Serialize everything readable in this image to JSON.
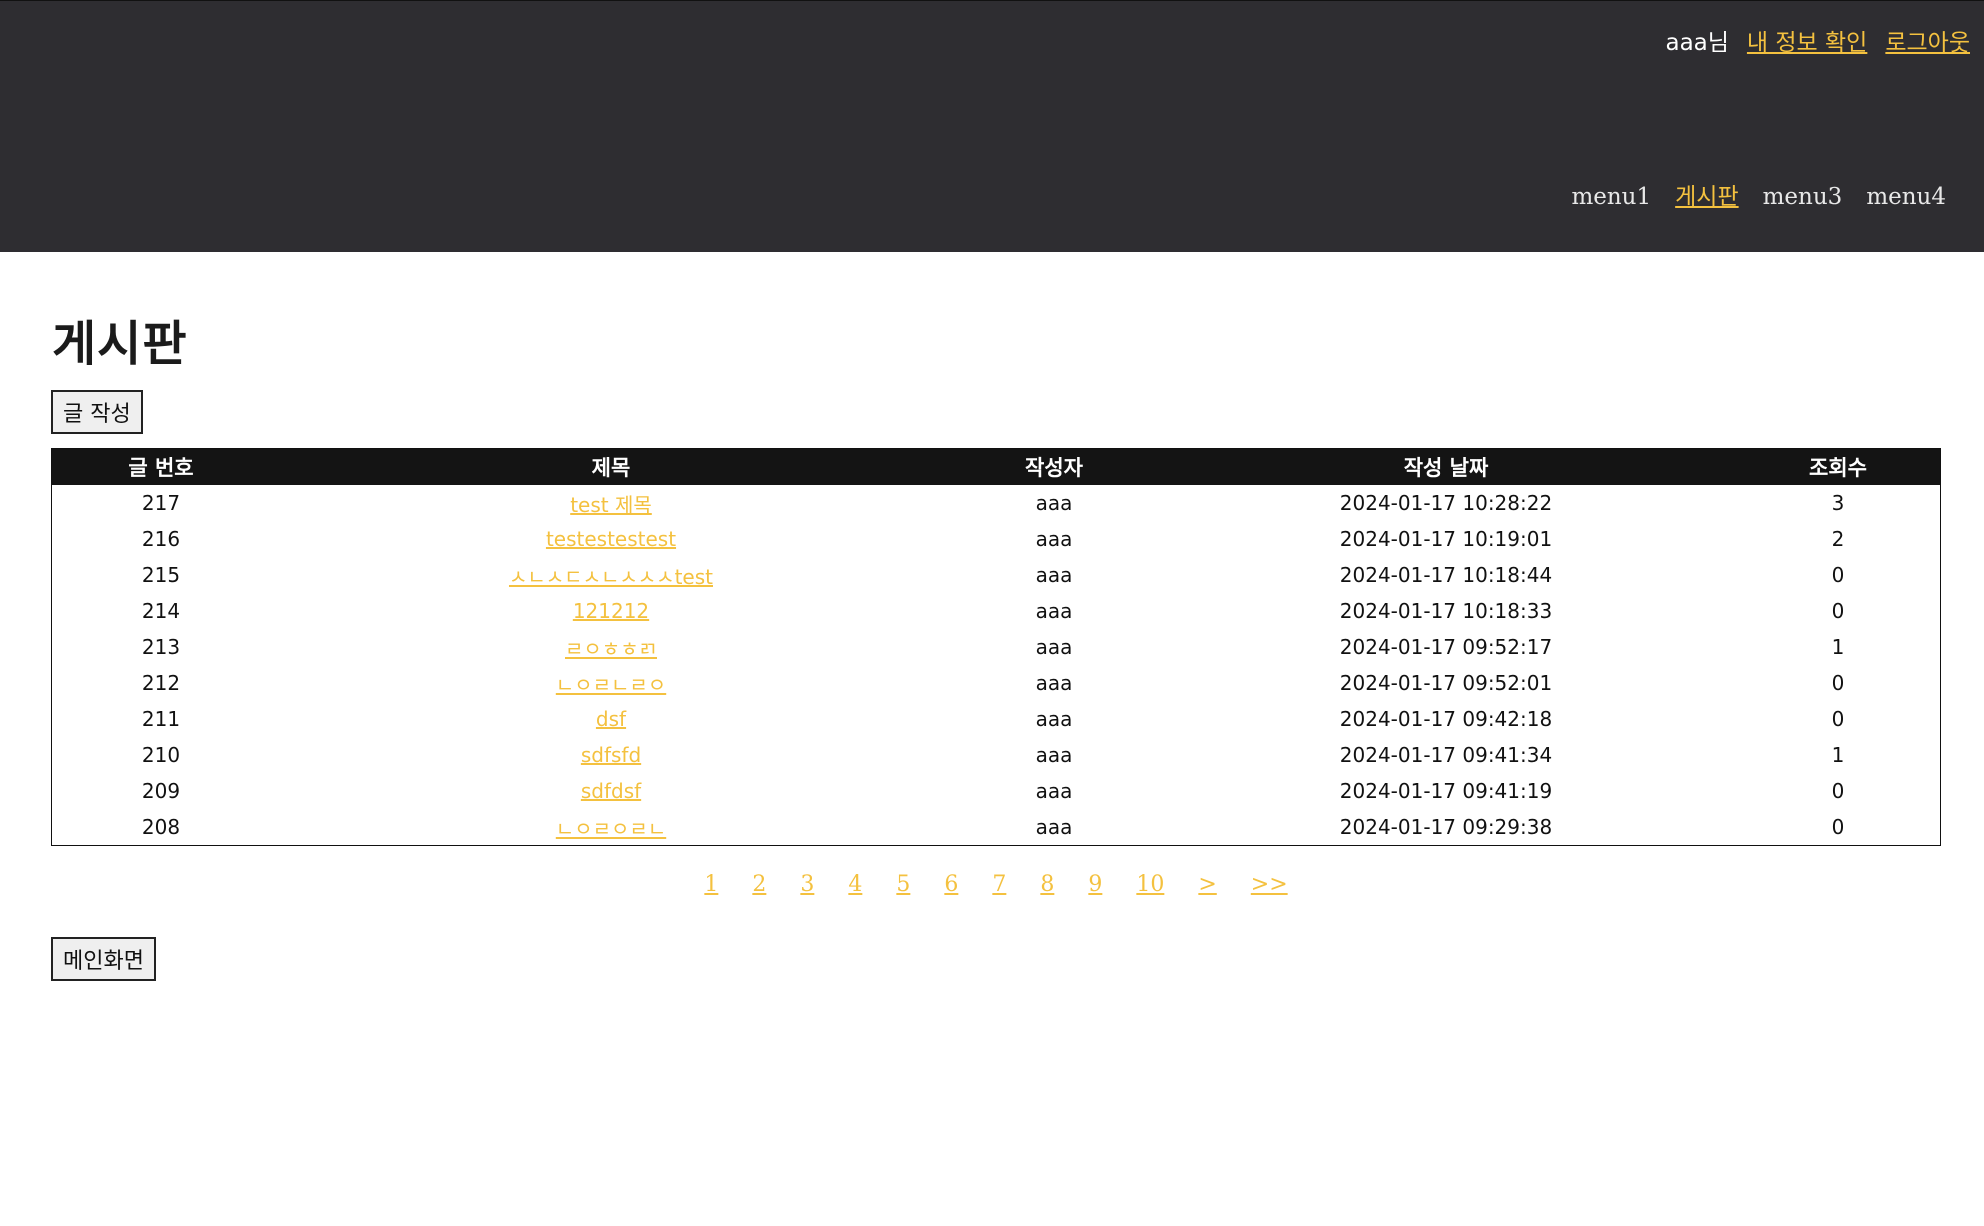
{
  "header": {
    "user_name": "aaa님",
    "my_info_link": "내 정보 확인",
    "logout_link": "로그아웃",
    "nav": [
      "menu1",
      "게시판",
      "menu3",
      "menu4"
    ]
  },
  "page_title": "게시판",
  "write_button": "글 작성",
  "table": {
    "columns": [
      "글 번호",
      "제목",
      "작성자",
      "작성 날짜",
      "조회수"
    ],
    "rows": [
      {
        "no": "217",
        "title": "test 제목",
        "author": "aaa",
        "date": "2024-01-17 10:28:22",
        "views": "3"
      },
      {
        "no": "216",
        "title": "testestestest",
        "author": "aaa",
        "date": "2024-01-17 10:19:01",
        "views": "2"
      },
      {
        "no": "215",
        "title": "ㅅㄴㅅㄷㅅㄴㅅㅅㅅtest",
        "author": "aaa",
        "date": "2024-01-17 10:18:44",
        "views": "0"
      },
      {
        "no": "214",
        "title": "121212",
        "author": "aaa",
        "date": "2024-01-17 10:18:33",
        "views": "0"
      },
      {
        "no": "213",
        "title": "ㄹㅇㅎㅎㄺ",
        "author": "aaa",
        "date": "2024-01-17 09:52:17",
        "views": "1"
      },
      {
        "no": "212",
        "title": "ㄴㅇㄹㄴㄹㅇ",
        "author": "aaa",
        "date": "2024-01-17 09:52:01",
        "views": "0"
      },
      {
        "no": "211",
        "title": "dsf",
        "author": "aaa",
        "date": "2024-01-17 09:42:18",
        "views": "0"
      },
      {
        "no": "210",
        "title": "sdfsfd",
        "author": "aaa",
        "date": "2024-01-17 09:41:34",
        "views": "1"
      },
      {
        "no": "209",
        "title": "sdfdsf",
        "author": "aaa",
        "date": "2024-01-17 09:41:19",
        "views": "0"
      },
      {
        "no": "208",
        "title": "ㄴㅇㄹㅇㄹㄴ",
        "author": "aaa",
        "date": "2024-01-17 09:29:38",
        "views": "0"
      }
    ]
  },
  "pagination": [
    "1",
    "2",
    "3",
    "4",
    "5",
    "6",
    "7",
    "8",
    "9",
    "10",
    ">",
    ">>"
  ],
  "main_button": "메인화면",
  "colors": {
    "header_bg": "#2e2d31",
    "link": "#f4c13f",
    "table_head_bg": "#141414"
  }
}
